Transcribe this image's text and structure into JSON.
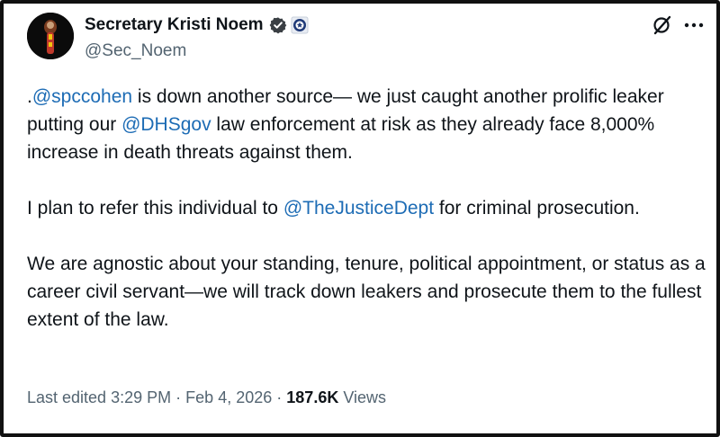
{
  "post": {
    "author": {
      "display_name": "Secretary Kristi Noem",
      "handle": "@Sec_Noem",
      "avatar_icon": "profile-avatar",
      "verified_icon": "verified-badge-icon",
      "affiliation_icon": "dhs-seal-icon"
    },
    "actions": {
      "grok_icon": "grok-icon",
      "more_icon": "more-options-icon"
    },
    "paragraphs": [
      [
        {
          "text": "."
        },
        {
          "text": "@spccohen",
          "mention": true
        },
        {
          "text": " is down another source— we just caught another prolific leaker putting our "
        },
        {
          "text": "@DHSgov",
          "mention": true
        },
        {
          "text": " law enforcement at risk as they already face 8,000% increase in death threats against them."
        }
      ],
      [
        {
          "text": "I plan to refer this individual to "
        },
        {
          "text": "@TheJusticeDept",
          "mention": true
        },
        {
          "text": " for criminal prosecution."
        }
      ],
      [
        {
          "text": "We are agnostic about your standing, tenure, political appointment, or status as a career civil servant—we will track down leakers and prosecute them to the fullest extent of the law."
        }
      ]
    ],
    "meta": {
      "edited_label": "Last edited",
      "time": "3:29 PM",
      "separator": "·",
      "date": "Feb 4, 2026",
      "views_count": "187.6K",
      "views_label": "Views"
    }
  },
  "colors": {
    "mention": "#1d6cb5",
    "muted": "#536471",
    "text": "#0f1419",
    "verified": "#1d9bf0"
  }
}
